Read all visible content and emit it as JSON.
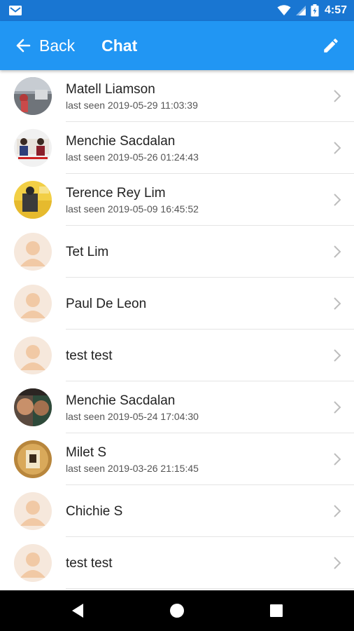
{
  "status_bar": {
    "time": "4:57",
    "icons": [
      "gmail-icon",
      "wifi-icon",
      "signal-icon",
      "battery-icon"
    ]
  },
  "app_bar": {
    "back_label": "Back",
    "title": "Chat",
    "action_icon": "pencil-icon",
    "color": "#2196f3"
  },
  "contacts": [
    {
      "name": "Matell Liamson",
      "last_seen": "last seen 2019-05-29 11:03:39",
      "avatar": "photo"
    },
    {
      "name": "Menchie Sacdalan",
      "last_seen": "last seen 2019-05-26 01:24:43",
      "avatar": "photo"
    },
    {
      "name": "Terence Rey Lim",
      "last_seen": "last seen 2019-05-09 16:45:52",
      "avatar": "photo"
    },
    {
      "name": "Tet Lim",
      "last_seen": "",
      "avatar": "default"
    },
    {
      "name": "Paul De Leon",
      "last_seen": "",
      "avatar": "default"
    },
    {
      "name": "test test",
      "last_seen": "",
      "avatar": "default"
    },
    {
      "name": "Menchie Sacdalan",
      "last_seen": "last seen 2019-05-24 17:04:30",
      "avatar": "photo"
    },
    {
      "name": "Milet S",
      "last_seen": "last seen 2019-03-26 21:15:45",
      "avatar": "photo"
    },
    {
      "name": "Chichie S",
      "last_seen": "",
      "avatar": "default"
    },
    {
      "name": "test test",
      "last_seen": "",
      "avatar": "default"
    }
  ],
  "nav_bar": {
    "buttons": [
      "back-triangle-icon",
      "home-circle-icon",
      "recents-square-icon"
    ]
  }
}
